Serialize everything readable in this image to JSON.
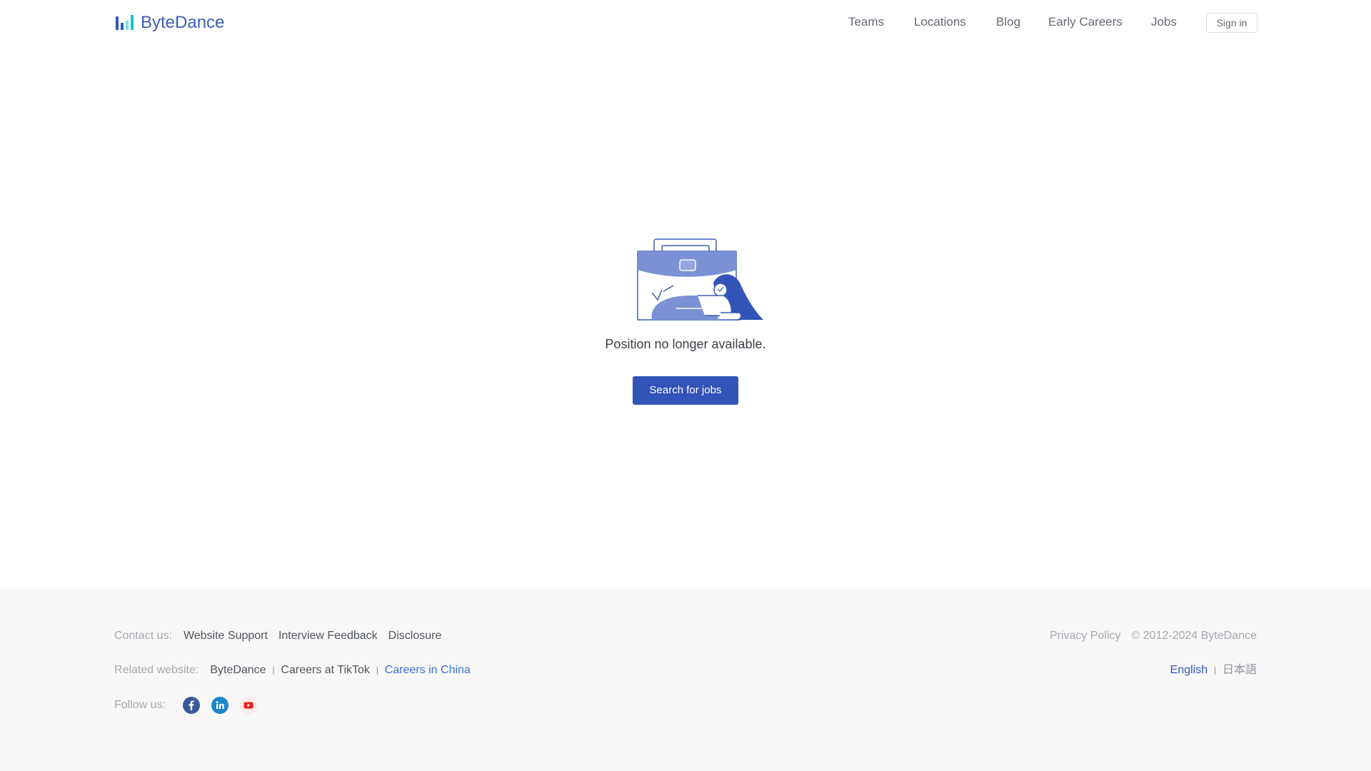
{
  "header": {
    "logo_text": "ByteDance",
    "nav": [
      "Teams",
      "Locations",
      "Blog",
      "Early Careers",
      "Jobs"
    ],
    "signin_label": "Sign in"
  },
  "main": {
    "message": "Position no longer available.",
    "search_button_label": "Search for jobs",
    "illustration_icon": "empty-briefcase-illustration"
  },
  "footer": {
    "contact_label": "Contact us:",
    "contact_links": [
      "Website Support",
      "Interview Feedback",
      "Disclosure"
    ],
    "related_label": "Related website:",
    "related_links": [
      "ByteDance",
      "Careers at TikTok",
      "Careers in China"
    ],
    "follow_label": "Follow us:",
    "social_icons": [
      "facebook-icon",
      "linkedin-icon",
      "youtube-icon"
    ],
    "privacy_label": "Privacy Policy",
    "copyright": "© 2012-2024 ByteDance",
    "languages": [
      "English",
      "日本語"
    ]
  },
  "colors": {
    "brand": "#3253b7",
    "link_blue": "#3c6fd6",
    "footer_bg": "#f8f8f8"
  }
}
